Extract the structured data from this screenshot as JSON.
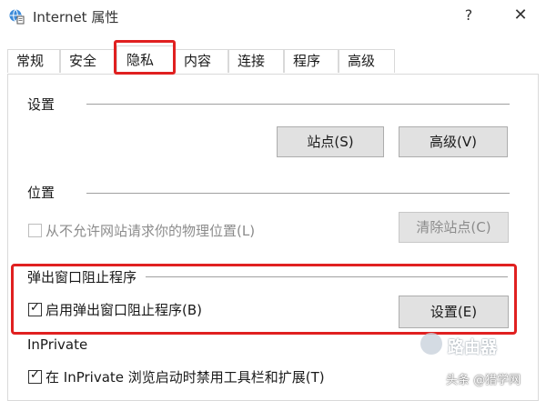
{
  "window": {
    "title": "Internet 属性",
    "help_glyph": "?",
    "close_glyph": "✕",
    "app_icon": "globe-doc-icon"
  },
  "tabs": [
    {
      "label": "常规"
    },
    {
      "label": "安全"
    },
    {
      "label": "隐私",
      "active": true
    },
    {
      "label": "内容"
    },
    {
      "label": "连接"
    },
    {
      "label": "程序"
    },
    {
      "label": "高级"
    }
  ],
  "settings": {
    "heading": "设置",
    "sites_button": "站点(S)",
    "advanced_button": "高级(V)"
  },
  "location": {
    "heading": "位置",
    "never_allow_label": "从不允许网站请求你的物理位置(L)",
    "never_allow_checked": false,
    "never_allow_enabled": false,
    "clear_sites_button": "清除站点(C)"
  },
  "popup_blocker": {
    "heading": "弹出窗口阻止程序",
    "enable_label": "启用弹出窗口阻止程序(B)",
    "enable_checked": true,
    "settings_button": "设置(E)"
  },
  "inprivate": {
    "heading": "InPrivate",
    "disable_toolbars_label": "在 InPrivate 浏览启动时禁用工具栏和扩展(T)",
    "disable_toolbars_checked": true
  },
  "watermark": {
    "brand": "路由器",
    "credit": "头条 @猎学网"
  },
  "colors": {
    "highlight": "#e02020",
    "button_face": "#e1e1e1",
    "disabled_text": "#8c8c8c"
  }
}
